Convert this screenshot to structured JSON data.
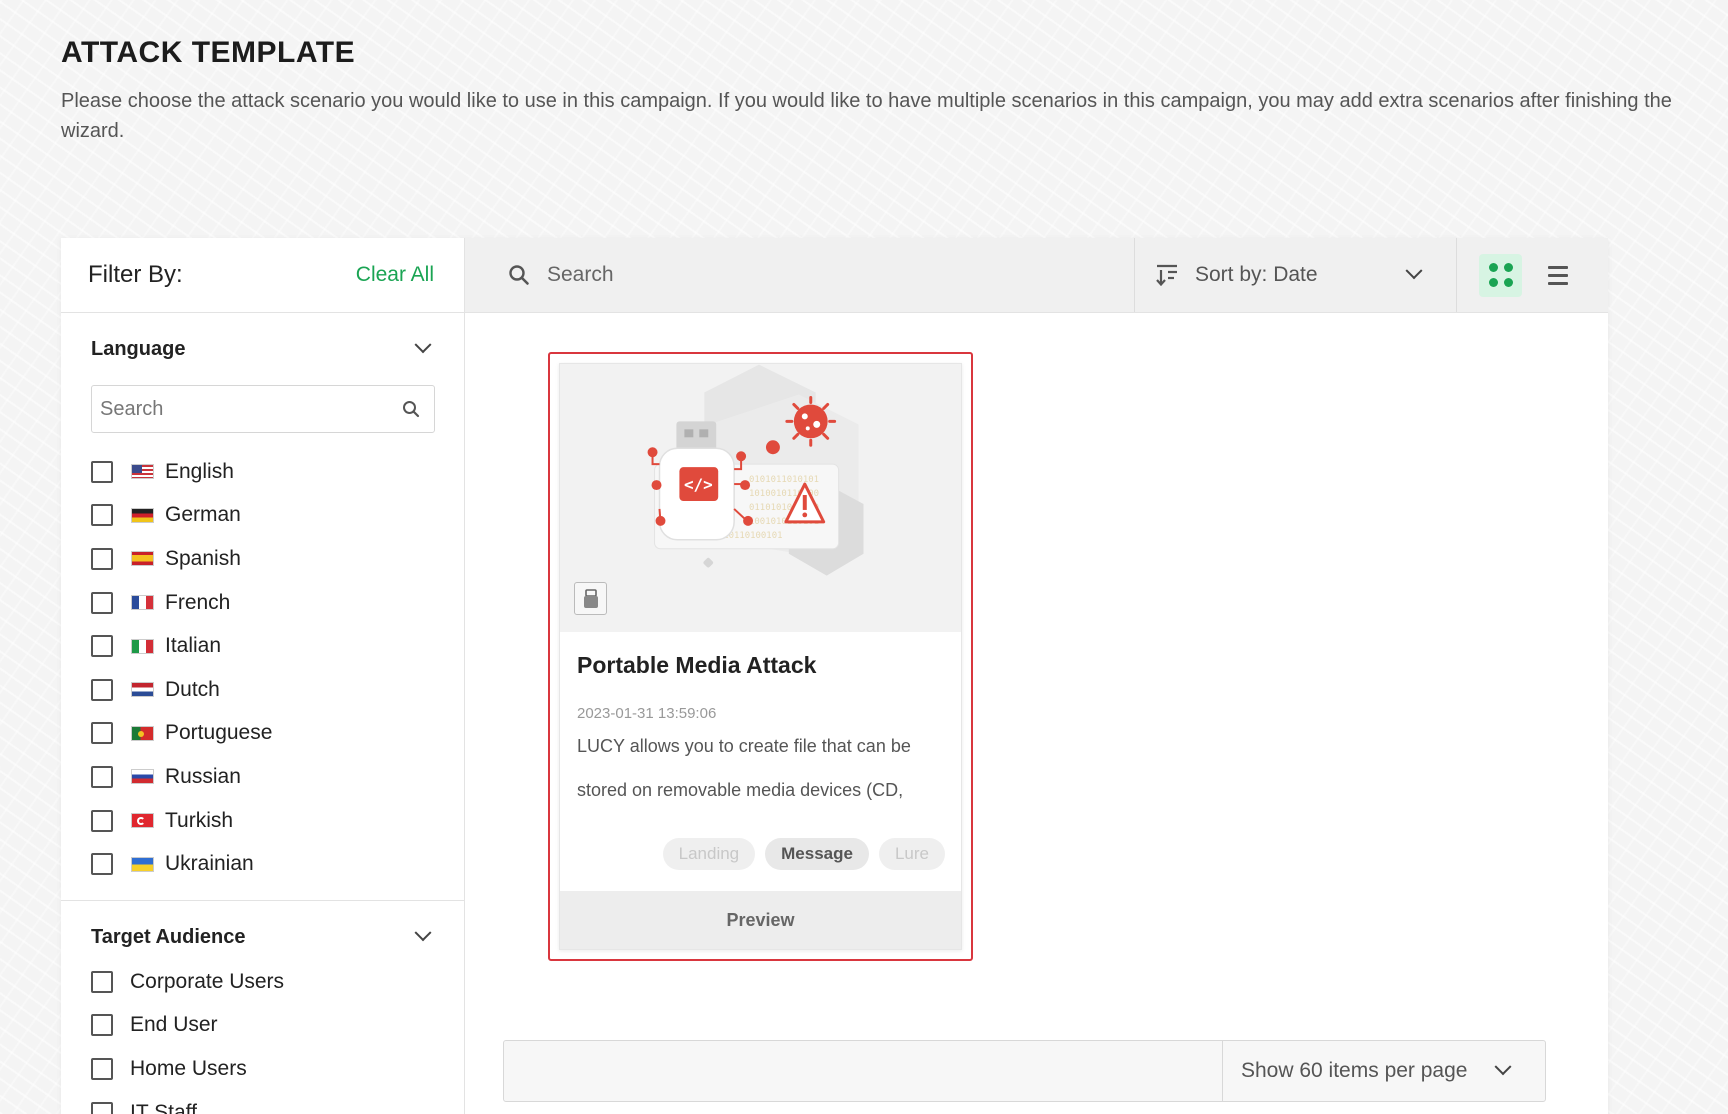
{
  "page": {
    "title": "ATTACK TEMPLATE",
    "description": "Please choose the attack scenario you would like to use in this campaign. If you would like to have multiple scenarios in this campaign, you may add extra scenarios after finishing the wizard."
  },
  "filter": {
    "title": "Filter By:",
    "clear_all": "Clear All",
    "language": {
      "title": "Language",
      "search_placeholder": "Search",
      "options": [
        "English",
        "German",
        "Spanish",
        "French",
        "Italian",
        "Dutch",
        "Portuguese",
        "Russian",
        "Turkish",
        "Ukrainian"
      ]
    },
    "audience": {
      "title": "Target Audience",
      "options": [
        "Corporate Users",
        "End User",
        "Home Users",
        "IT Staff"
      ]
    }
  },
  "toolbar": {
    "search_placeholder": "Search",
    "sort_label": "Sort by: Date",
    "active_view": "grid"
  },
  "card": {
    "title": "Portable Media Attack",
    "date": "2023-01-31 13:59:06",
    "description": "LUCY allows you to create file that can be stored on removable media devices (CD,",
    "tags": [
      {
        "label": "Landing",
        "active": false
      },
      {
        "label": "Message",
        "active": true
      },
      {
        "label": "Lure",
        "active": false
      }
    ],
    "preview_label": "Preview",
    "selected": true
  },
  "pagination": {
    "per_page_label": "Show 60 items per page"
  },
  "colors": {
    "accent_green": "#1aa453",
    "selection_red": "#d9363e",
    "illustration_red": "#e04a3c"
  }
}
